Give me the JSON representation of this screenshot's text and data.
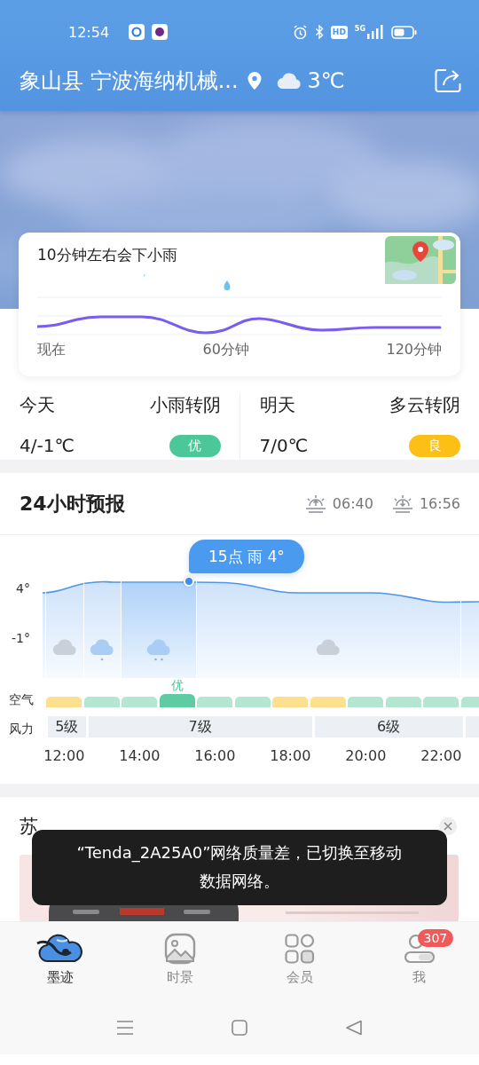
{
  "status_bar": {
    "time": "12:54",
    "hd": "HD",
    "network": "5G"
  },
  "header": {
    "location": "象山县 宁波海纳机械...",
    "temperature": "3℃"
  },
  "rain_card": {
    "title": "10分钟左右会下小雨",
    "axis_labels": [
      "现在",
      "60分钟",
      "120分钟"
    ]
  },
  "days": [
    {
      "label": "今天",
      "condition": "小雨转阴",
      "range": "4/-1℃",
      "aqi": "优",
      "color": "#4cc79a"
    },
    {
      "label": "明天",
      "condition": "多云转阴",
      "range": "7/0℃",
      "aqi": "良",
      "color": "#fbbf16"
    }
  ],
  "forecast_24h": {
    "title": "24小时预报",
    "sunrise": "06:40",
    "sunset": "16:56",
    "tooltip": "15点 雨 4°",
    "y_labels": [
      "4°",
      "-1°"
    ],
    "air_label": "空气",
    "wind_label": "风力",
    "hours": [
      {
        "time": "12:00",
        "weather_start": true,
        "kind": "cloudy",
        "wind_start": true,
        "wind": "5级",
        "color": "#fce08e",
        "selected": false
      },
      {
        "weather_start": true,
        "kind": "light_rain",
        "wind_start": true,
        "wind": "7级",
        "color": "#b4e6d2",
        "selected": false
      },
      {
        "time": "14:00",
        "weather_start": true,
        "kind": "rain",
        "wind_start": false,
        "color": "#b4e6d2",
        "selected": false
      },
      {
        "weather_start": false,
        "wind_start": false,
        "color": "#5fcba2",
        "air_text": "优",
        "selected": true
      },
      {
        "time": "16:00",
        "weather_start": true,
        "kind": "cloudy",
        "wind_start": false,
        "color": "#b4e6d2",
        "selected": false
      },
      {
        "weather_start": false,
        "wind_start": false,
        "color": "#b4e6d2",
        "selected": false
      },
      {
        "time": "18:00",
        "weather_start": false,
        "wind_start": false,
        "color": "#fce08e",
        "selected": false
      },
      {
        "weather_start": false,
        "wind_start": true,
        "wind": "6级",
        "color": "#fce08e",
        "selected": false
      },
      {
        "time": "20:00",
        "weather_start": false,
        "wind_start": false,
        "color": "#b4e6d2",
        "selected": false
      },
      {
        "weather_start": false,
        "wind_start": false,
        "color": "#b4e6d2",
        "selected": false
      },
      {
        "time": "22:00",
        "weather_start": false,
        "wind_start": false,
        "color": "#b4e6d2",
        "selected": false
      },
      {
        "weather_start": true,
        "wind_start": true,
        "color": "#b4e6d2",
        "selected": false
      }
    ]
  },
  "ad": {
    "title": "苏"
  },
  "toast": {
    "text": "“Tenda_2A25A0”网络质量差，已切换至移动数据网络。"
  },
  "tab_bar": [
    {
      "label": "墨迹",
      "selected": true
    },
    {
      "label": "时景",
      "selected": false
    },
    {
      "label": "会员",
      "selected": false
    },
    {
      "label": "我",
      "selected": false,
      "badge": "307"
    }
  ]
}
